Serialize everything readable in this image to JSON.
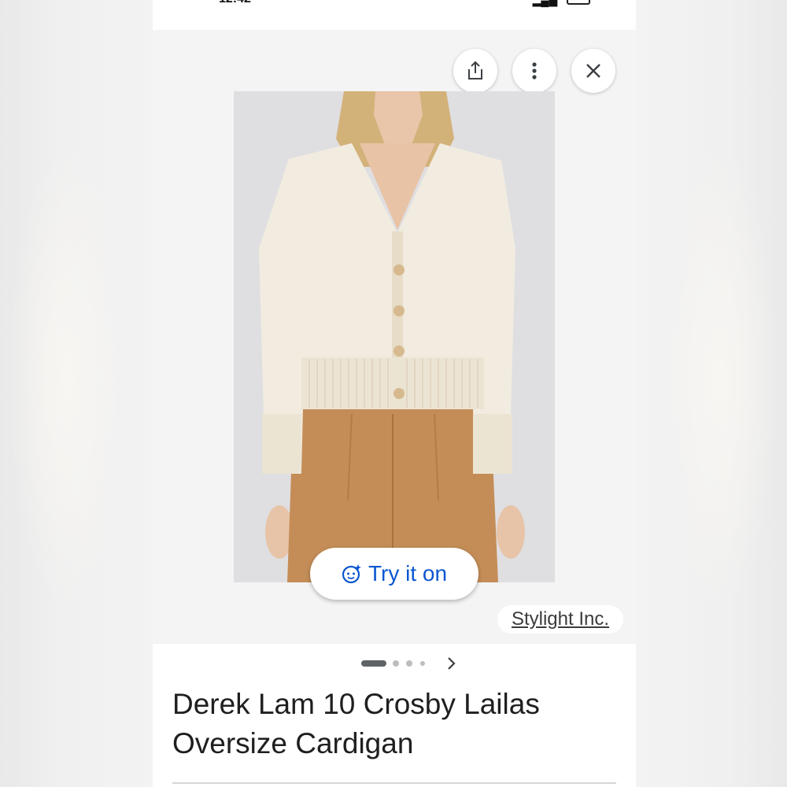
{
  "status_bar": {
    "time": "12:42"
  },
  "viewer": {
    "share_icon": "share-icon",
    "more_icon": "more-vertical-icon",
    "close_icon": "close-icon",
    "try_on_icon": "face-sparkle-icon",
    "try_on_label": "Try it on",
    "source_label": "Stylight Inc."
  },
  "pager": {
    "page_count": 4,
    "current_page": 1,
    "next_icon": "chevron-right-icon"
  },
  "product": {
    "title": "Derek Lam 10 Crosby Lailas Oversize Cardigan"
  },
  "colors": {
    "accent_blue": "#0b57d0",
    "pager_active": "#5f6368",
    "pager_inactive": "#bdbdbd",
    "sweater_cream": "#f1ebdd",
    "pants_camel": "#c48d57"
  }
}
